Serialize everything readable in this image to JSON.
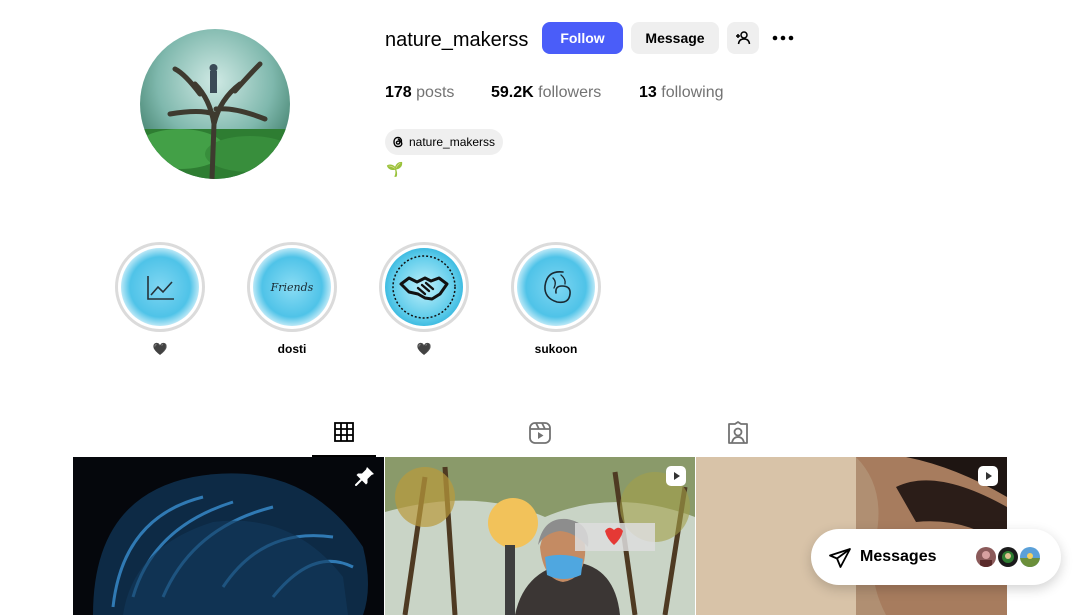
{
  "profile": {
    "username": "nature_makerss",
    "follow_label": "Follow",
    "message_label": "Message",
    "threads_handle": "nature_makerss",
    "bio": "🌱"
  },
  "stats": {
    "posts_count": "178",
    "posts_label": "posts",
    "followers_count": "59.2K",
    "followers_label": "followers",
    "following_count": "13",
    "following_label": "following"
  },
  "highlights": [
    {
      "label": "🖤",
      "icon": "chart-icon"
    },
    {
      "label": "dosti",
      "icon": "friends-text-icon"
    },
    {
      "label": "🖤",
      "icon": "handshake-icon"
    },
    {
      "label": "sukoon",
      "icon": "sukoon-icon"
    }
  ],
  "tabs": [
    {
      "name": "posts",
      "icon": "grid-icon",
      "active": true
    },
    {
      "name": "reels",
      "icon": "reels-icon",
      "active": false
    },
    {
      "name": "tagged",
      "icon": "tagged-icon",
      "active": false
    }
  ],
  "posts": [
    {
      "badge": "pin-icon"
    },
    {
      "badge": "reel-icon"
    },
    {
      "badge": "reel-icon"
    }
  ],
  "messages": {
    "label": "Messages"
  },
  "colors": {
    "follow_button": "#4a5df9",
    "secondary_button": "#efefef",
    "muted_text": "#737373",
    "highlight_blue": "#4fc3e8"
  }
}
